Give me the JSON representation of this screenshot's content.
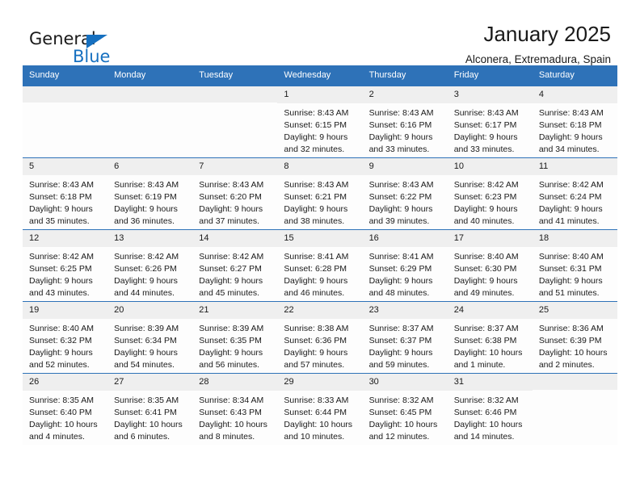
{
  "logo": {
    "word_one": "General",
    "word_two": "Blue",
    "triangle_color": "#1670C0"
  },
  "header": {
    "title": "January 2025",
    "location": "Alconera, Extremadura, Spain"
  },
  "colors": {
    "header_blue": "#2E72B8",
    "date_band": "#EFEFEF",
    "cell_background": "#FDFDFD",
    "text": "#1a1a1a"
  },
  "weekdays": [
    "Sunday",
    "Monday",
    "Tuesday",
    "Wednesday",
    "Thursday",
    "Friday",
    "Saturday"
  ],
  "weeks": [
    [
      {
        "day": "",
        "sunrise": "",
        "sunset": "",
        "daylight_line1": "",
        "daylight_line2": ""
      },
      {
        "day": "",
        "sunrise": "",
        "sunset": "",
        "daylight_line1": "",
        "daylight_line2": ""
      },
      {
        "day": "",
        "sunrise": "",
        "sunset": "",
        "daylight_line1": "",
        "daylight_line2": ""
      },
      {
        "day": "1",
        "sunrise": "Sunrise: 8:43 AM",
        "sunset": "Sunset: 6:15 PM",
        "daylight_line1": "Daylight: 9 hours",
        "daylight_line2": "and 32 minutes."
      },
      {
        "day": "2",
        "sunrise": "Sunrise: 8:43 AM",
        "sunset": "Sunset: 6:16 PM",
        "daylight_line1": "Daylight: 9 hours",
        "daylight_line2": "and 33 minutes."
      },
      {
        "day": "3",
        "sunrise": "Sunrise: 8:43 AM",
        "sunset": "Sunset: 6:17 PM",
        "daylight_line1": "Daylight: 9 hours",
        "daylight_line2": "and 33 minutes."
      },
      {
        "day": "4",
        "sunrise": "Sunrise: 8:43 AM",
        "sunset": "Sunset: 6:18 PM",
        "daylight_line1": "Daylight: 9 hours",
        "daylight_line2": "and 34 minutes."
      }
    ],
    [
      {
        "day": "5",
        "sunrise": "Sunrise: 8:43 AM",
        "sunset": "Sunset: 6:18 PM",
        "daylight_line1": "Daylight: 9 hours",
        "daylight_line2": "and 35 minutes."
      },
      {
        "day": "6",
        "sunrise": "Sunrise: 8:43 AM",
        "sunset": "Sunset: 6:19 PM",
        "daylight_line1": "Daylight: 9 hours",
        "daylight_line2": "and 36 minutes."
      },
      {
        "day": "7",
        "sunrise": "Sunrise: 8:43 AM",
        "sunset": "Sunset: 6:20 PM",
        "daylight_line1": "Daylight: 9 hours",
        "daylight_line2": "and 37 minutes."
      },
      {
        "day": "8",
        "sunrise": "Sunrise: 8:43 AM",
        "sunset": "Sunset: 6:21 PM",
        "daylight_line1": "Daylight: 9 hours",
        "daylight_line2": "and 38 minutes."
      },
      {
        "day": "9",
        "sunrise": "Sunrise: 8:43 AM",
        "sunset": "Sunset: 6:22 PM",
        "daylight_line1": "Daylight: 9 hours",
        "daylight_line2": "and 39 minutes."
      },
      {
        "day": "10",
        "sunrise": "Sunrise: 8:42 AM",
        "sunset": "Sunset: 6:23 PM",
        "daylight_line1": "Daylight: 9 hours",
        "daylight_line2": "and 40 minutes."
      },
      {
        "day": "11",
        "sunrise": "Sunrise: 8:42 AM",
        "sunset": "Sunset: 6:24 PM",
        "daylight_line1": "Daylight: 9 hours",
        "daylight_line2": "and 41 minutes."
      }
    ],
    [
      {
        "day": "12",
        "sunrise": "Sunrise: 8:42 AM",
        "sunset": "Sunset: 6:25 PM",
        "daylight_line1": "Daylight: 9 hours",
        "daylight_line2": "and 43 minutes."
      },
      {
        "day": "13",
        "sunrise": "Sunrise: 8:42 AM",
        "sunset": "Sunset: 6:26 PM",
        "daylight_line1": "Daylight: 9 hours",
        "daylight_line2": "and 44 minutes."
      },
      {
        "day": "14",
        "sunrise": "Sunrise: 8:42 AM",
        "sunset": "Sunset: 6:27 PM",
        "daylight_line1": "Daylight: 9 hours",
        "daylight_line2": "and 45 minutes."
      },
      {
        "day": "15",
        "sunrise": "Sunrise: 8:41 AM",
        "sunset": "Sunset: 6:28 PM",
        "daylight_line1": "Daylight: 9 hours",
        "daylight_line2": "and 46 minutes."
      },
      {
        "day": "16",
        "sunrise": "Sunrise: 8:41 AM",
        "sunset": "Sunset: 6:29 PM",
        "daylight_line1": "Daylight: 9 hours",
        "daylight_line2": "and 48 minutes."
      },
      {
        "day": "17",
        "sunrise": "Sunrise: 8:40 AM",
        "sunset": "Sunset: 6:30 PM",
        "daylight_line1": "Daylight: 9 hours",
        "daylight_line2": "and 49 minutes."
      },
      {
        "day": "18",
        "sunrise": "Sunrise: 8:40 AM",
        "sunset": "Sunset: 6:31 PM",
        "daylight_line1": "Daylight: 9 hours",
        "daylight_line2": "and 51 minutes."
      }
    ],
    [
      {
        "day": "19",
        "sunrise": "Sunrise: 8:40 AM",
        "sunset": "Sunset: 6:32 PM",
        "daylight_line1": "Daylight: 9 hours",
        "daylight_line2": "and 52 minutes."
      },
      {
        "day": "20",
        "sunrise": "Sunrise: 8:39 AM",
        "sunset": "Sunset: 6:34 PM",
        "daylight_line1": "Daylight: 9 hours",
        "daylight_line2": "and 54 minutes."
      },
      {
        "day": "21",
        "sunrise": "Sunrise: 8:39 AM",
        "sunset": "Sunset: 6:35 PM",
        "daylight_line1": "Daylight: 9 hours",
        "daylight_line2": "and 56 minutes."
      },
      {
        "day": "22",
        "sunrise": "Sunrise: 8:38 AM",
        "sunset": "Sunset: 6:36 PM",
        "daylight_line1": "Daylight: 9 hours",
        "daylight_line2": "and 57 minutes."
      },
      {
        "day": "23",
        "sunrise": "Sunrise: 8:37 AM",
        "sunset": "Sunset: 6:37 PM",
        "daylight_line1": "Daylight: 9 hours",
        "daylight_line2": "and 59 minutes."
      },
      {
        "day": "24",
        "sunrise": "Sunrise: 8:37 AM",
        "sunset": "Sunset: 6:38 PM",
        "daylight_line1": "Daylight: 10 hours",
        "daylight_line2": "and 1 minute."
      },
      {
        "day": "25",
        "sunrise": "Sunrise: 8:36 AM",
        "sunset": "Sunset: 6:39 PM",
        "daylight_line1": "Daylight: 10 hours",
        "daylight_line2": "and 2 minutes."
      }
    ],
    [
      {
        "day": "26",
        "sunrise": "Sunrise: 8:35 AM",
        "sunset": "Sunset: 6:40 PM",
        "daylight_line1": "Daylight: 10 hours",
        "daylight_line2": "and 4 minutes."
      },
      {
        "day": "27",
        "sunrise": "Sunrise: 8:35 AM",
        "sunset": "Sunset: 6:41 PM",
        "daylight_line1": "Daylight: 10 hours",
        "daylight_line2": "and 6 minutes."
      },
      {
        "day": "28",
        "sunrise": "Sunrise: 8:34 AM",
        "sunset": "Sunset: 6:43 PM",
        "daylight_line1": "Daylight: 10 hours",
        "daylight_line2": "and 8 minutes."
      },
      {
        "day": "29",
        "sunrise": "Sunrise: 8:33 AM",
        "sunset": "Sunset: 6:44 PM",
        "daylight_line1": "Daylight: 10 hours",
        "daylight_line2": "and 10 minutes."
      },
      {
        "day": "30",
        "sunrise": "Sunrise: 8:32 AM",
        "sunset": "Sunset: 6:45 PM",
        "daylight_line1": "Daylight: 10 hours",
        "daylight_line2": "and 12 minutes."
      },
      {
        "day": "31",
        "sunrise": "Sunrise: 8:32 AM",
        "sunset": "Sunset: 6:46 PM",
        "daylight_line1": "Daylight: 10 hours",
        "daylight_line2": "and 14 minutes."
      },
      {
        "day": "",
        "sunrise": "",
        "sunset": "",
        "daylight_line1": "",
        "daylight_line2": ""
      }
    ]
  ]
}
